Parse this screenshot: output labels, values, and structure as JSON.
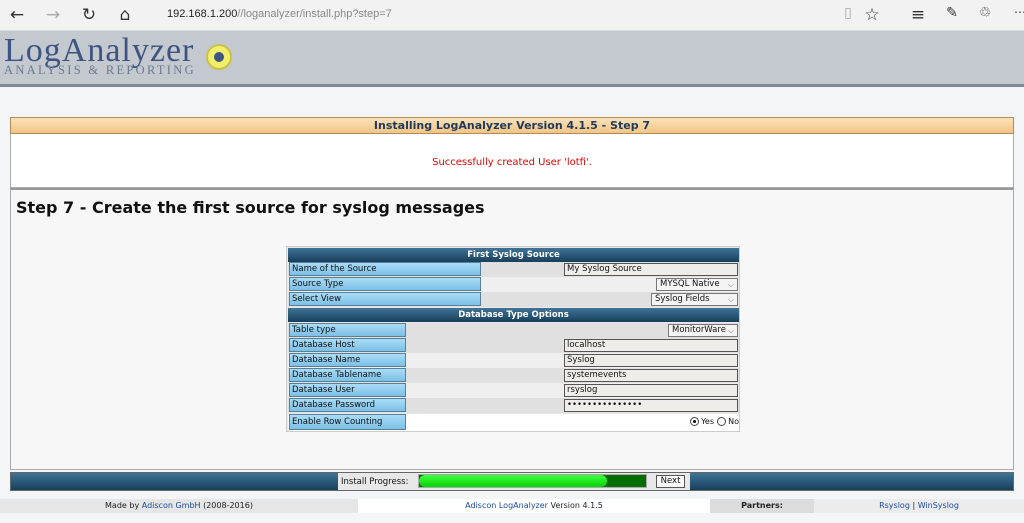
{
  "browser": {
    "url_host": "192.168.1.200",
    "url_path": "//loganalyzer/install.php?step=7"
  },
  "logo": {
    "name": "LogAnalyzer",
    "tagline": "ANALYSIS & REPORTING"
  },
  "title": "Installing LogAnalyzer Version 4.1.5 - Step 7",
  "message": "Successfully created User 'lotfi'.",
  "message_color": "#e00000",
  "step_heading": "Step 7 - Create the first source for syslog messages",
  "section1": {
    "title": "First Syslog Source",
    "rows": [
      {
        "label": "Name of the Source",
        "value": "My Syslog Source",
        "type": "input"
      },
      {
        "label": "Source Type",
        "value": "MYSQL Native",
        "type": "select"
      },
      {
        "label": "Select View",
        "value": "Syslog Fields",
        "type": "select"
      }
    ]
  },
  "section2": {
    "title": "Database Type Options",
    "rows": [
      {
        "label": "Table type",
        "value": "MonitorWare",
        "type": "select"
      },
      {
        "label": "Database Host",
        "value": "localhost",
        "type": "input"
      },
      {
        "label": "Database Name",
        "value": "Syslog",
        "type": "input"
      },
      {
        "label": "Database Tablename",
        "value": "systemevents",
        "type": "input"
      },
      {
        "label": "Database User",
        "value": "rsyslog",
        "type": "input"
      },
      {
        "label": "Database Password",
        "value": "•••••••••••••••",
        "type": "password"
      }
    ],
    "row_counting": {
      "label": "Enable Row Counting",
      "yes": "Yes",
      "no": "No",
      "selected": "Yes"
    }
  },
  "progress": {
    "label": "Install Progress:",
    "percent": 83,
    "next": "Next"
  },
  "footer": {
    "made_by": "Made by",
    "company": "Adiscon GmbH",
    "years": "(2008-2016)",
    "product": "Adiscon LogAnalyzer",
    "version": "Version 4.1.5",
    "partners": "Partners:",
    "link1": "Rsyslog",
    "sep": "|",
    "link2": "WinSyslog"
  }
}
